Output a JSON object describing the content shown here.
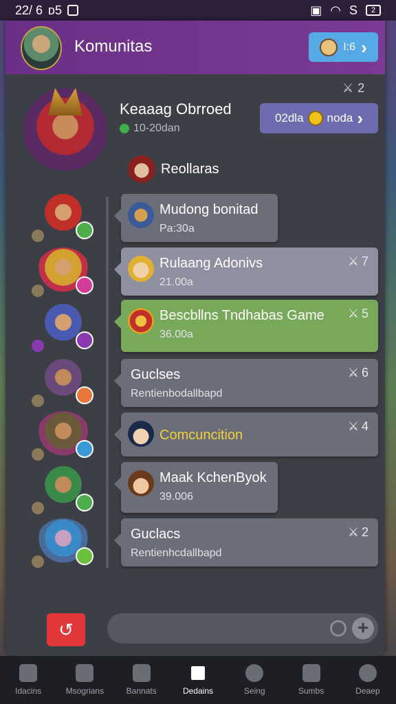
{
  "status": {
    "time": "22/ 6",
    "icon_label": "ᴅ5",
    "battery": "S",
    "bat_level": "2"
  },
  "header": {
    "title": "Komunitas",
    "button_label": "I:6"
  },
  "top_counter": "2",
  "group": {
    "name": "Keaaag Obrroed",
    "sub": "10-20dan",
    "join_label_left": "02dla",
    "join_label_right": "noda"
  },
  "sender": {
    "name": "Reollaras"
  },
  "messages": [
    {
      "title": "Mudong bonitad",
      "sub": "Pa:30a",
      "count": ""
    },
    {
      "title": "Rulaang Adonivs",
      "sub": "21.00a",
      "count": "7"
    },
    {
      "title": "Bescbllns Tndhabas Game",
      "sub": "36.00a",
      "count": "5"
    },
    {
      "title": "Guclses",
      "sub": "Rentienbodallbapd",
      "count": "6"
    },
    {
      "title": "Comcuncition",
      "sub": "",
      "count": "4"
    },
    {
      "title": "Maak KchenByok",
      "sub": "39.006",
      "count": ""
    },
    {
      "title": "Guclacs",
      "sub": "Rentienhcdallbapd",
      "count": "2"
    }
  ],
  "nav": [
    {
      "label": "Idacins"
    },
    {
      "label": "Msogrians"
    },
    {
      "label": "Bannats"
    },
    {
      "label": "Dedains"
    },
    {
      "label": "Seing"
    },
    {
      "label": "Sumbs"
    },
    {
      "label": "Deaep"
    }
  ],
  "colors": {
    "header": "#7b3b95",
    "accent_blue": "#57a9e6",
    "green_card": "#78a85a",
    "red_button": "#e2383a"
  }
}
